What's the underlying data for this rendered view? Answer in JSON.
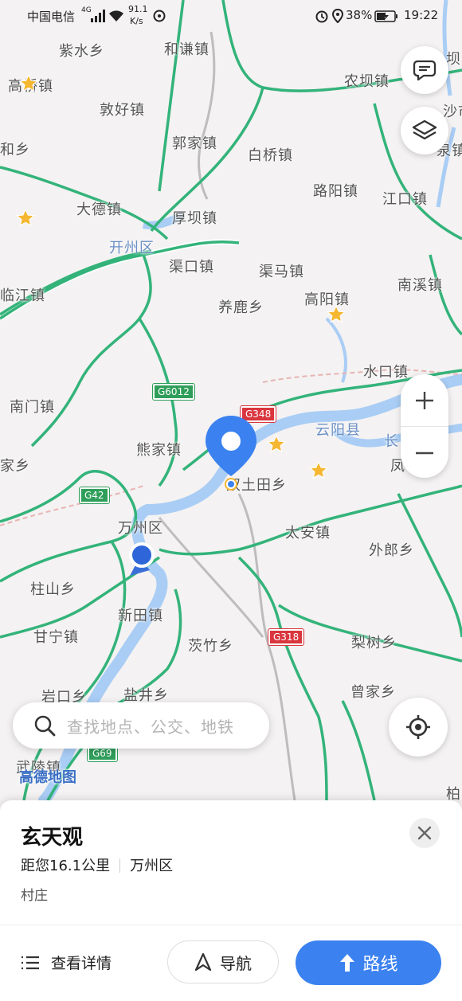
{
  "status": {
    "carrier": "中国电信",
    "network": "4G",
    "speed_value": "91.1",
    "speed_unit": "K/s",
    "battery": "38%",
    "time": "19:22"
  },
  "map": {
    "places": [
      "紫水乡",
      "和谦镇",
      "高桥镇",
      "农坝镇",
      "敦好镇",
      "沙市",
      "郭家镇",
      "白桥镇",
      "和乡",
      "路阳镇",
      "江口镇",
      "大德镇",
      "厚坝镇",
      "开州区",
      "渠口镇",
      "渠马镇",
      "临江镇",
      "养鹿乡",
      "高阳镇",
      "南溪镇",
      "水口镇",
      "南门镇",
      "熊家镇",
      "云阳县",
      "家乡",
      "凤",
      "双土田乡",
      "万州区",
      "太安镇",
      "外郎乡",
      "柱山乡",
      "新田镇",
      "茨竹乡",
      "梨树乡",
      "甘宁镇",
      "曾家乡",
      "岩口乡",
      "盐井乡",
      "武陵镇",
      "柏",
      "坝",
      "泉镇",
      "长"
    ],
    "shields": [
      "G6012",
      "G348",
      "G42",
      "G318",
      "G69"
    ],
    "logo": "高德地图"
  },
  "colors": {
    "road": "#33b37a",
    "river": "#9ec6f3",
    "accent": "#3b82f0",
    "shield_red": "#d9363e"
  },
  "search": {
    "placeholder": "查找地点、公交、地铁"
  },
  "place_card": {
    "name": "玄天观",
    "distance": "距您16.1公里",
    "district": "万州区",
    "category": "村庄",
    "details_label": "查看详情",
    "navigate_label": "导航",
    "route_label": "路线"
  }
}
